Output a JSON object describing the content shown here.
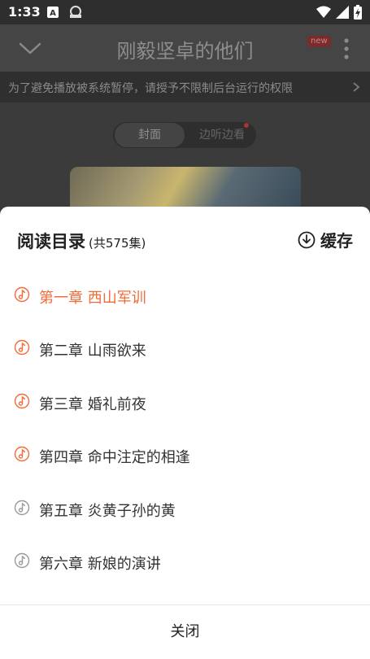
{
  "status_bar": {
    "time": "1:33"
  },
  "header": {
    "title": "刚毅坚卓的他们",
    "badge": "new"
  },
  "notice": {
    "text": "为了避免播放被系统暂停，请授予不限制后台运行的权限"
  },
  "toggle": {
    "options": [
      "封面",
      "边听边看"
    ],
    "selected": "封面"
  },
  "sheet": {
    "title": "阅读目录",
    "count": "(共575集)",
    "cache_label": "缓存",
    "chapters": [
      {
        "label": "第一章 西山军训",
        "state": "playing"
      },
      {
        "label": "第二章 山雨欲来",
        "state": "downloaded"
      },
      {
        "label": "第三章 婚礼前夜",
        "state": "downloaded"
      },
      {
        "label": "第四章 命中注定的相逢",
        "state": "downloaded"
      },
      {
        "label": "第五章 炎黄子孙的黄",
        "state": "normal"
      },
      {
        "label": "第六章 新娘的演讲",
        "state": "normal"
      }
    ],
    "close_label": "关闭"
  },
  "colors": {
    "accent": "#f26b38",
    "muted_icon": "#9a9a9a"
  },
  "icons": [
    "chevron-down-icon",
    "more-vertical-icon",
    "chevron-right-icon",
    "download-icon",
    "music-note-icon"
  ]
}
